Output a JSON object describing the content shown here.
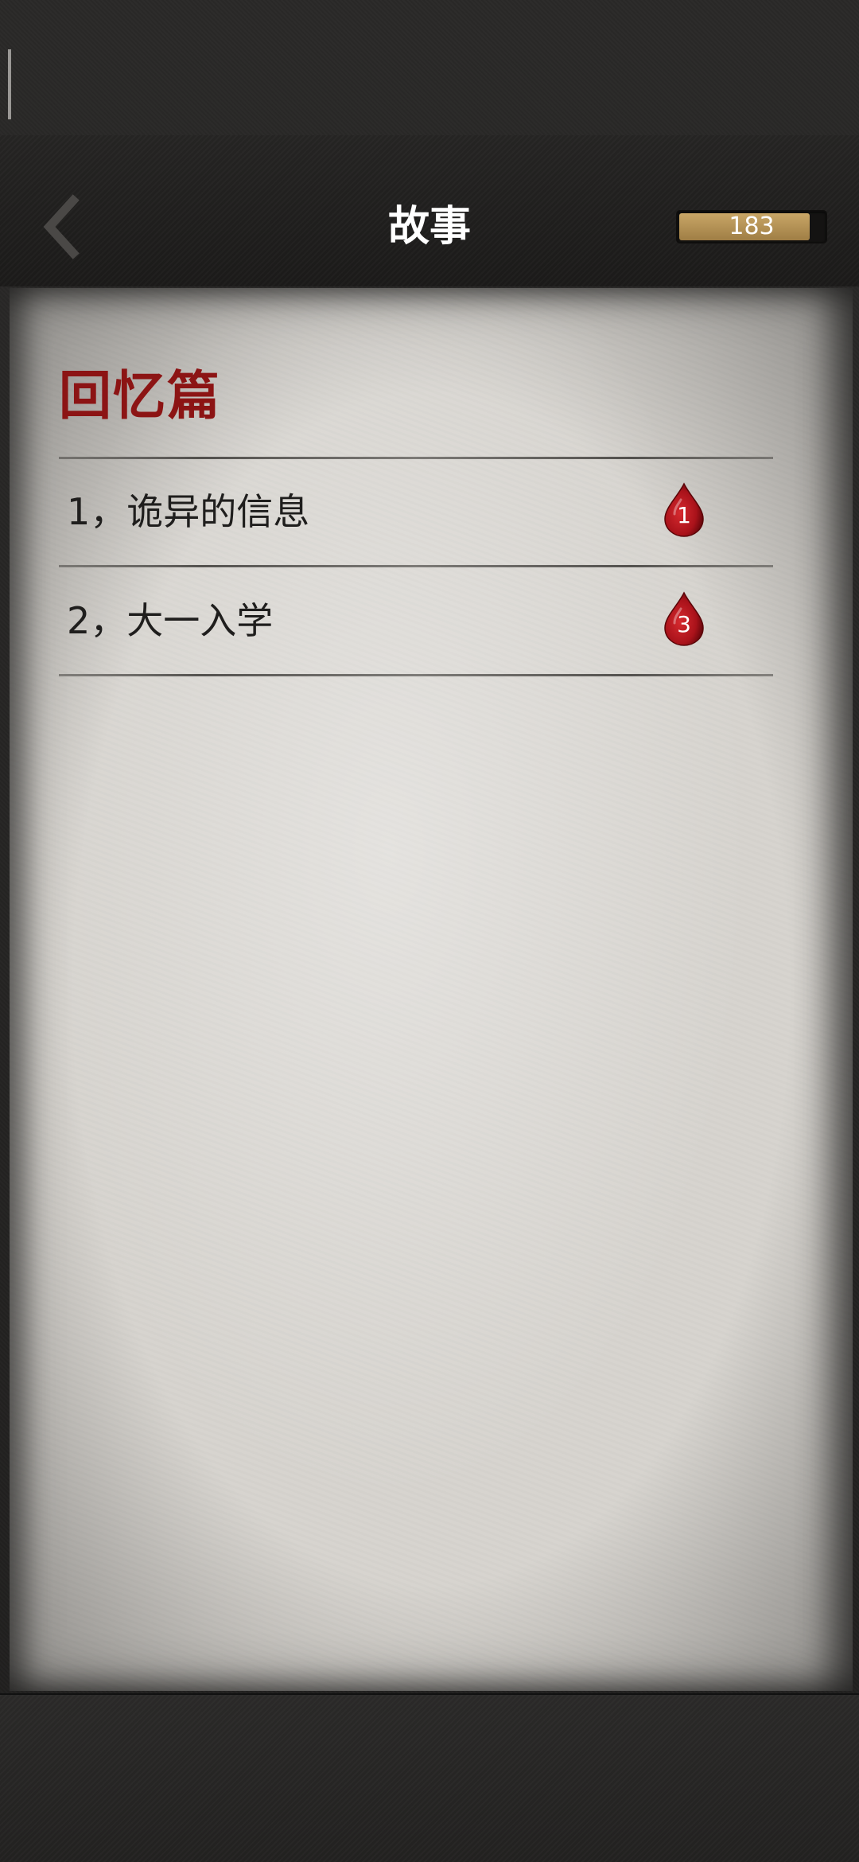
{
  "header": {
    "title": "故事",
    "back_icon": "chevron-left-icon",
    "coins": "183",
    "coin_fill_fraction": 0.9
  },
  "section": {
    "title": "回忆篇"
  },
  "stories": [
    {
      "label": "1，诡异的信息",
      "badge": "1",
      "badge_icon": "blood-drop-icon"
    },
    {
      "label": "2，大一入学",
      "badge": "3",
      "badge_icon": "blood-drop-icon"
    }
  ],
  "colors": {
    "accent": "#8c1414",
    "badge": "#b0161c",
    "coin_fill": "#b8965a"
  }
}
